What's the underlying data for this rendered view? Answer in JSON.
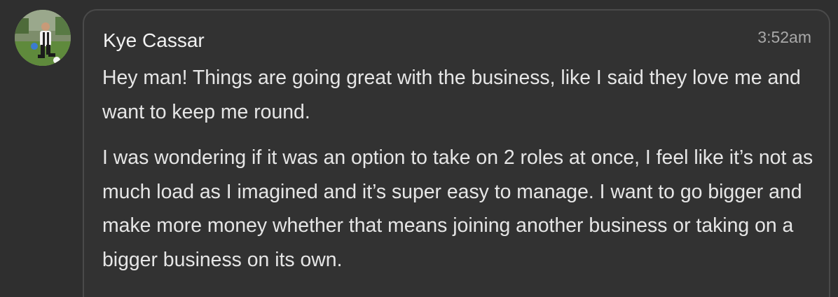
{
  "message": {
    "sender": "Kye Cassar",
    "time": "3:52am",
    "paragraphs": [
      "Hey man! Things are going great with the business, like I said they love me and want to keep me round.",
      "I was wondering if it was an option to take on 2 roles at once, I feel like it’s not as much load as I imagined and it’s super easy to manage. I want to go bigger and make more money whether that means joining another business or taking on a bigger business on its own."
    ]
  },
  "colors": {
    "background": "#2f2f2f",
    "bubble_border": "#4a4a4a",
    "text": "#e6e6e6",
    "timestamp": "#a8a8a8"
  },
  "icons": {
    "avatar": "user-avatar-photo"
  }
}
